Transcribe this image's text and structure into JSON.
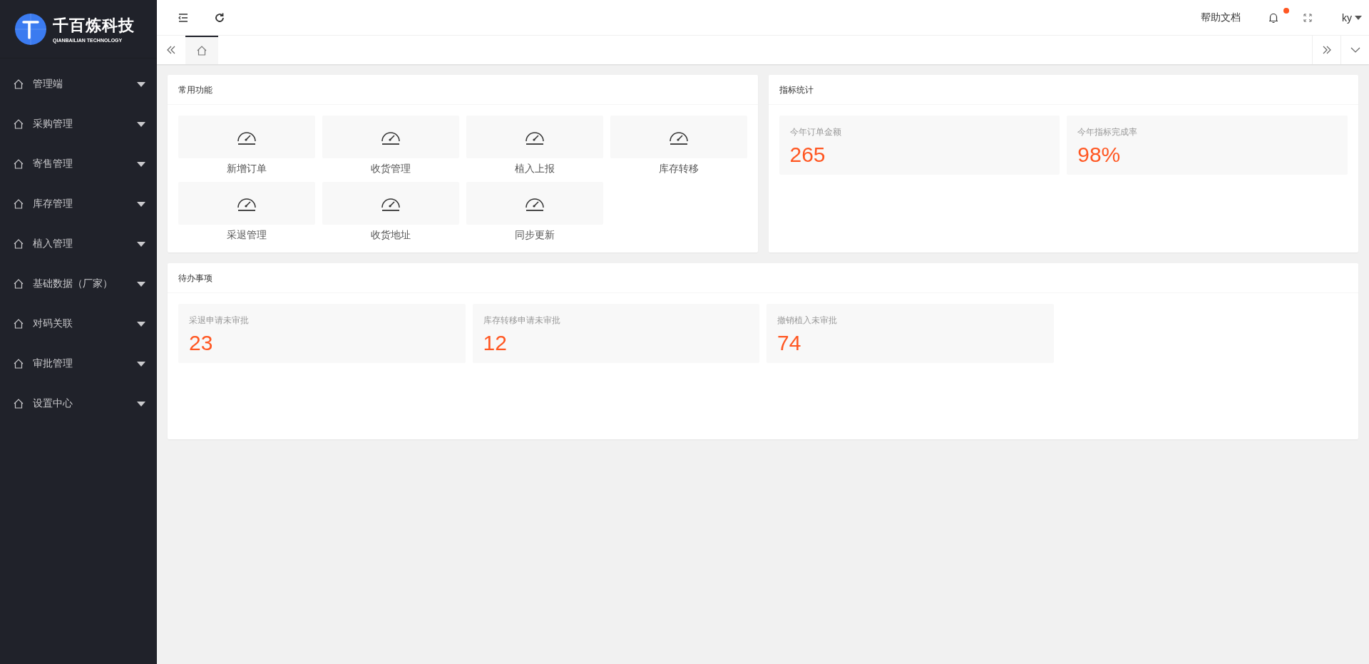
{
  "sidebar": {
    "logo": {
      "title": "千百炼科技",
      "subtitle": "QIANBAILIAN TECHNOLOGY"
    },
    "items": [
      {
        "label": "管理端",
        "expanded": false
      },
      {
        "label": "采购管理",
        "expanded": false
      },
      {
        "label": "寄售管理",
        "expanded": false
      },
      {
        "label": "库存管理",
        "expanded": false
      },
      {
        "label": "植入管理",
        "expanded": false
      },
      {
        "label": "基础数据（厂家）",
        "expanded": false
      },
      {
        "label": "对码关联",
        "expanded": false
      },
      {
        "label": "审批管理",
        "expanded": false
      },
      {
        "label": "设置中心",
        "expanded": false
      }
    ]
  },
  "header": {
    "help": "帮助文档",
    "notifications": {
      "unread": true
    },
    "user": "ky"
  },
  "tabs": [
    {
      "kind": "home",
      "selected": true
    }
  ],
  "shortcuts": {
    "title": "常用功能",
    "items": [
      {
        "label": "新增订单"
      },
      {
        "label": "收货管理"
      },
      {
        "label": "植入上报"
      },
      {
        "label": "库存转移"
      },
      {
        "label": "采退管理"
      },
      {
        "label": "收货地址"
      },
      {
        "label": "同步更新"
      }
    ]
  },
  "stats": {
    "title": "指标统计",
    "items": [
      {
        "label": "今年订单金额",
        "value": "265"
      },
      {
        "label": "今年指标完成率",
        "value": "98%"
      }
    ]
  },
  "todos": {
    "title": "待办事项",
    "items": [
      {
        "label": "采退申请未审批",
        "value": "23"
      },
      {
        "label": "库存转移申请未审批",
        "value": "12"
      },
      {
        "label": "撤销植入未审批",
        "value": "74"
      }
    ]
  }
}
